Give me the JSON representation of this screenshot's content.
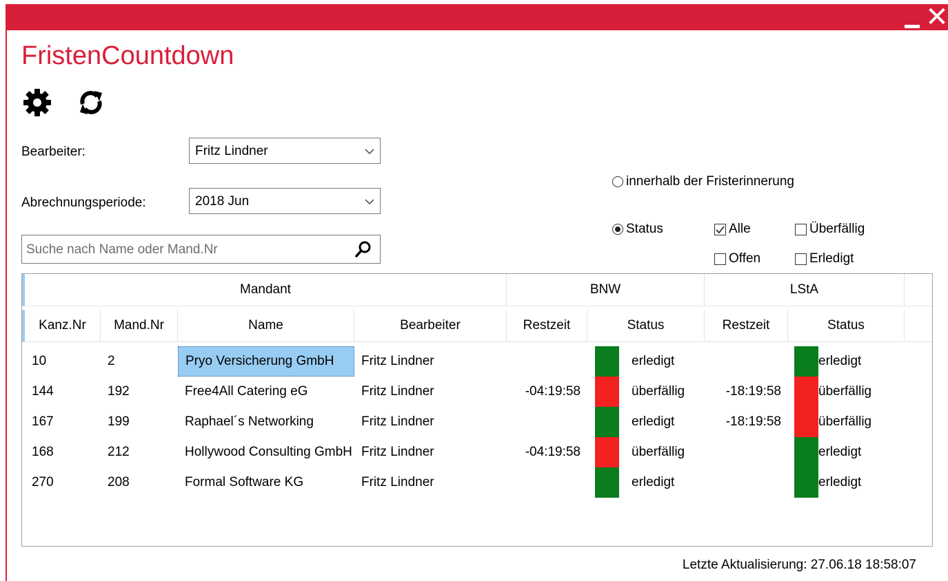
{
  "window": {
    "close_glyph": "✕"
  },
  "app": {
    "title": "FristenCountdown"
  },
  "toolbar": {
    "settings_icon": "gear-icon",
    "refresh_icon": "refresh-icon"
  },
  "filters": {
    "bearbeiter_label": "Bearbeiter:",
    "bearbeiter_value": "Fritz Lindner",
    "periode_label": "Abrechnungsperiode:",
    "periode_value": "2018 Jun",
    "search_placeholder": "Suche nach Name oder Mand.Nr",
    "radio_innerhalb": "innerhalb der Fristerinnerung",
    "radio_status": "Status",
    "chk_alle": "Alle",
    "chk_ueberfaellig": "Überfällig",
    "chk_offen": "Offen",
    "chk_erledigt": "Erledigt",
    "radio_innerhalb_selected": false,
    "radio_status_selected": true,
    "chk_alle_checked": true,
    "chk_ueberfaellig_checked": false,
    "chk_offen_checked": false,
    "chk_erledigt_checked": false
  },
  "grid": {
    "groups": [
      "Mandant",
      "BNW",
      "LStA"
    ],
    "columns": [
      "Kanz.Nr",
      "Mand.Nr",
      "Name",
      "Bearbeiter",
      "Restzeit",
      "Status",
      "Restzeit",
      "Status"
    ],
    "rows": [
      {
        "kanz": "10",
        "mand": "2",
        "name": "Pryo Versicherung GmbH",
        "bearb": "Fritz Lindner",
        "bnw_rest": "",
        "bnw_status": "erledigt",
        "lsta_rest": "",
        "lsta_status": "erledigt"
      },
      {
        "kanz": "144",
        "mand": "192",
        "name": "Free4All Catering eG",
        "bearb": "Fritz Lindner",
        "bnw_rest": "-04:19:58",
        "bnw_status": "überfällig",
        "lsta_rest": "-18:19:58",
        "lsta_status": "überfällig"
      },
      {
        "kanz": "167",
        "mand": "199",
        "name": "Raphael´s Networking",
        "bearb": "Fritz Lindner",
        "bnw_rest": "",
        "bnw_status": "erledigt",
        "lsta_rest": "-18:19:58",
        "lsta_status": "überfällig"
      },
      {
        "kanz": "168",
        "mand": "212",
        "name": "Hollywood Consulting GmbH",
        "bearb": "Fritz Lindner",
        "bnw_rest": "-04:19:58",
        "bnw_status": "überfällig",
        "lsta_rest": "",
        "lsta_status": "erledigt"
      },
      {
        "kanz": "270",
        "mand": "208",
        "name": "Formal Software KG",
        "bearb": "Fritz Lindner",
        "bnw_rest": "",
        "bnw_status": "erledigt",
        "lsta_rest": "",
        "lsta_status": "erledigt"
      }
    ],
    "status_colors": {
      "erledigt": "#0a7d1e",
      "überfällig": "#f42121"
    }
  },
  "footer": {
    "last_update": "Letzte Aktualisierung: 27.06.18 18:58:07"
  },
  "colors": {
    "accent": "#d81f3a",
    "selection": "#99ccf3"
  }
}
